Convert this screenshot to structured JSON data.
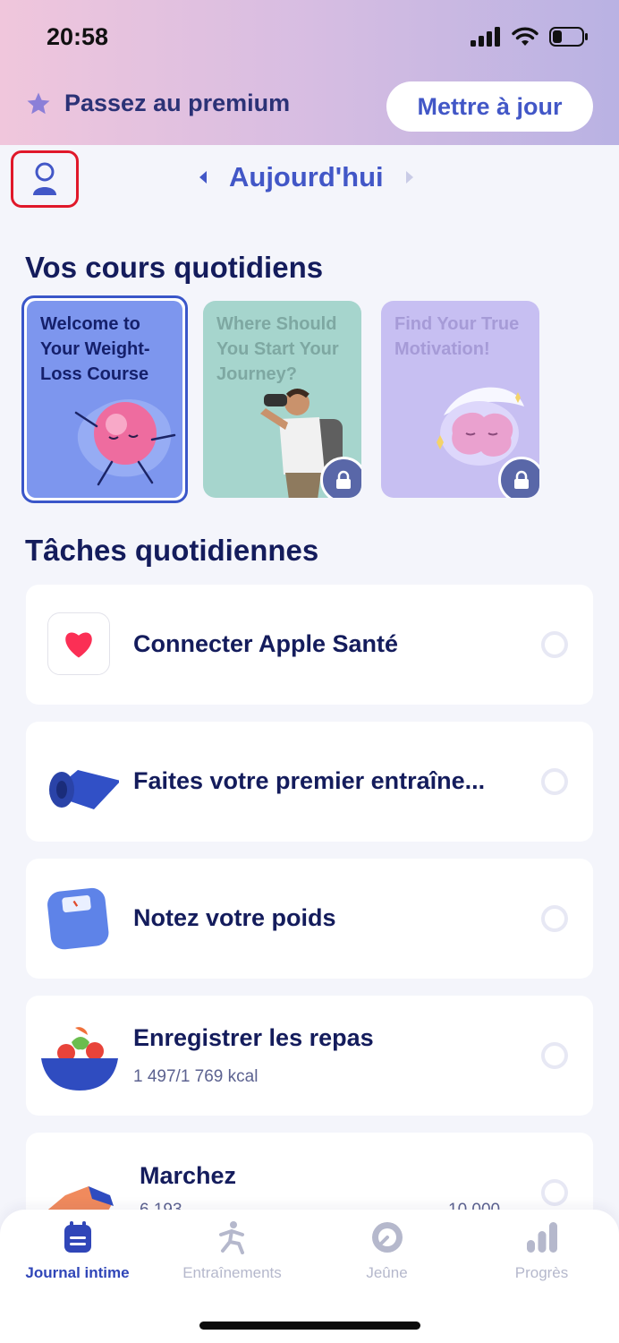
{
  "status": {
    "time": "20:58"
  },
  "premium": {
    "label": "Passez au premium",
    "button": "Mettre à jour"
  },
  "date_nav": {
    "label": "Aujourd'hui"
  },
  "courses": {
    "title": "Vos cours quotidiens",
    "items": [
      {
        "title": "Welcome to Your Weight-Loss Course",
        "locked": false
      },
      {
        "title": "Where Should You Start Your Journey?",
        "locked": true
      },
      {
        "title": "Find Your True Motivation!",
        "locked": true
      }
    ]
  },
  "tasks": {
    "title": "Tâches quotidiennes",
    "items": [
      {
        "title": "Connecter Apple Santé",
        "subtitle": ""
      },
      {
        "title": "Faites votre premier entraîne...",
        "subtitle": ""
      },
      {
        "title": "Notez votre poids",
        "subtitle": ""
      },
      {
        "title": "Enregistrer les repas",
        "subtitle": "1 497/1 769 kcal"
      },
      {
        "title": "Marchez",
        "subtitle": "6 193",
        "goal": "10 000"
      }
    ]
  },
  "bottom_nav": {
    "items": [
      {
        "label": "Journal intime",
        "icon": "calendar-icon",
        "active": true
      },
      {
        "label": "Entraînements",
        "icon": "run-icon",
        "active": false
      },
      {
        "label": "Jeûne",
        "icon": "fasting-clock-icon",
        "active": false
      },
      {
        "label": "Progrès",
        "icon": "bar-chart-icon",
        "active": false
      }
    ]
  },
  "colors": {
    "accent": "#4257c7",
    "dark": "#141c5c",
    "highlight": "#e0182a"
  }
}
